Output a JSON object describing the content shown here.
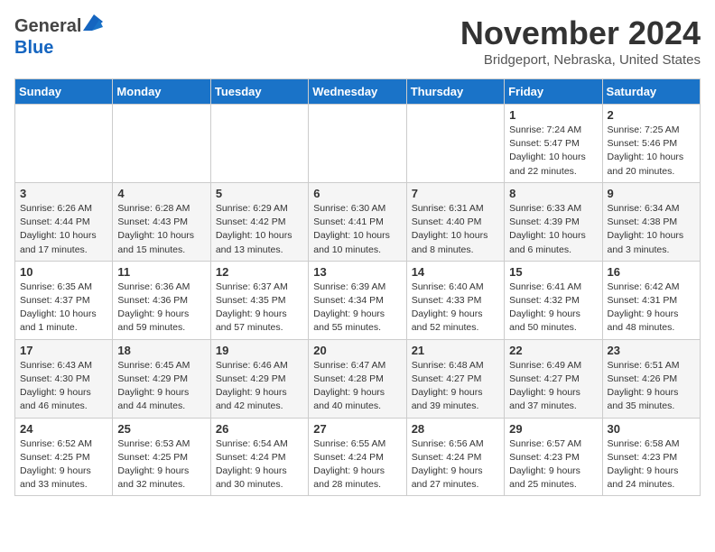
{
  "header": {
    "logo_general": "General",
    "logo_blue": "Blue",
    "month_title": "November 2024",
    "location": "Bridgeport, Nebraska, United States"
  },
  "days_of_week": [
    "Sunday",
    "Monday",
    "Tuesday",
    "Wednesday",
    "Thursday",
    "Friday",
    "Saturday"
  ],
  "weeks": [
    [
      {
        "day": "",
        "info": ""
      },
      {
        "day": "",
        "info": ""
      },
      {
        "day": "",
        "info": ""
      },
      {
        "day": "",
        "info": ""
      },
      {
        "day": "",
        "info": ""
      },
      {
        "day": "1",
        "info": "Sunrise: 7:24 AM\nSunset: 5:47 PM\nDaylight: 10 hours and 22 minutes."
      },
      {
        "day": "2",
        "info": "Sunrise: 7:25 AM\nSunset: 5:46 PM\nDaylight: 10 hours and 20 minutes."
      }
    ],
    [
      {
        "day": "3",
        "info": "Sunrise: 6:26 AM\nSunset: 4:44 PM\nDaylight: 10 hours and 17 minutes."
      },
      {
        "day": "4",
        "info": "Sunrise: 6:28 AM\nSunset: 4:43 PM\nDaylight: 10 hours and 15 minutes."
      },
      {
        "day": "5",
        "info": "Sunrise: 6:29 AM\nSunset: 4:42 PM\nDaylight: 10 hours and 13 minutes."
      },
      {
        "day": "6",
        "info": "Sunrise: 6:30 AM\nSunset: 4:41 PM\nDaylight: 10 hours and 10 minutes."
      },
      {
        "day": "7",
        "info": "Sunrise: 6:31 AM\nSunset: 4:40 PM\nDaylight: 10 hours and 8 minutes."
      },
      {
        "day": "8",
        "info": "Sunrise: 6:33 AM\nSunset: 4:39 PM\nDaylight: 10 hours and 6 minutes."
      },
      {
        "day": "9",
        "info": "Sunrise: 6:34 AM\nSunset: 4:38 PM\nDaylight: 10 hours and 3 minutes."
      }
    ],
    [
      {
        "day": "10",
        "info": "Sunrise: 6:35 AM\nSunset: 4:37 PM\nDaylight: 10 hours and 1 minute."
      },
      {
        "day": "11",
        "info": "Sunrise: 6:36 AM\nSunset: 4:36 PM\nDaylight: 9 hours and 59 minutes."
      },
      {
        "day": "12",
        "info": "Sunrise: 6:37 AM\nSunset: 4:35 PM\nDaylight: 9 hours and 57 minutes."
      },
      {
        "day": "13",
        "info": "Sunrise: 6:39 AM\nSunset: 4:34 PM\nDaylight: 9 hours and 55 minutes."
      },
      {
        "day": "14",
        "info": "Sunrise: 6:40 AM\nSunset: 4:33 PM\nDaylight: 9 hours and 52 minutes."
      },
      {
        "day": "15",
        "info": "Sunrise: 6:41 AM\nSunset: 4:32 PM\nDaylight: 9 hours and 50 minutes."
      },
      {
        "day": "16",
        "info": "Sunrise: 6:42 AM\nSunset: 4:31 PM\nDaylight: 9 hours and 48 minutes."
      }
    ],
    [
      {
        "day": "17",
        "info": "Sunrise: 6:43 AM\nSunset: 4:30 PM\nDaylight: 9 hours and 46 minutes."
      },
      {
        "day": "18",
        "info": "Sunrise: 6:45 AM\nSunset: 4:29 PM\nDaylight: 9 hours and 44 minutes."
      },
      {
        "day": "19",
        "info": "Sunrise: 6:46 AM\nSunset: 4:29 PM\nDaylight: 9 hours and 42 minutes."
      },
      {
        "day": "20",
        "info": "Sunrise: 6:47 AM\nSunset: 4:28 PM\nDaylight: 9 hours and 40 minutes."
      },
      {
        "day": "21",
        "info": "Sunrise: 6:48 AM\nSunset: 4:27 PM\nDaylight: 9 hours and 39 minutes."
      },
      {
        "day": "22",
        "info": "Sunrise: 6:49 AM\nSunset: 4:27 PM\nDaylight: 9 hours and 37 minutes."
      },
      {
        "day": "23",
        "info": "Sunrise: 6:51 AM\nSunset: 4:26 PM\nDaylight: 9 hours and 35 minutes."
      }
    ],
    [
      {
        "day": "24",
        "info": "Sunrise: 6:52 AM\nSunset: 4:25 PM\nDaylight: 9 hours and 33 minutes."
      },
      {
        "day": "25",
        "info": "Sunrise: 6:53 AM\nSunset: 4:25 PM\nDaylight: 9 hours and 32 minutes."
      },
      {
        "day": "26",
        "info": "Sunrise: 6:54 AM\nSunset: 4:24 PM\nDaylight: 9 hours and 30 minutes."
      },
      {
        "day": "27",
        "info": "Sunrise: 6:55 AM\nSunset: 4:24 PM\nDaylight: 9 hours and 28 minutes."
      },
      {
        "day": "28",
        "info": "Sunrise: 6:56 AM\nSunset: 4:24 PM\nDaylight: 9 hours and 27 minutes."
      },
      {
        "day": "29",
        "info": "Sunrise: 6:57 AM\nSunset: 4:23 PM\nDaylight: 9 hours and 25 minutes."
      },
      {
        "day": "30",
        "info": "Sunrise: 6:58 AM\nSunset: 4:23 PM\nDaylight: 9 hours and 24 minutes."
      }
    ]
  ]
}
